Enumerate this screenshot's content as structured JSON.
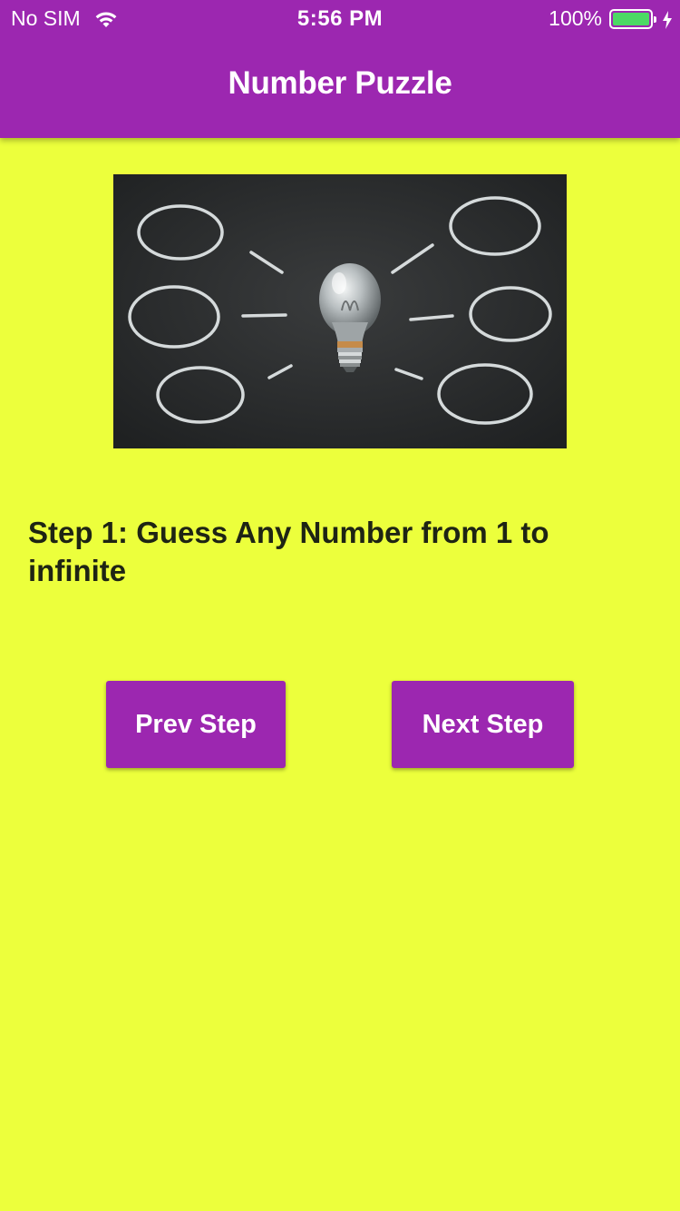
{
  "status_bar": {
    "carrier": "No SIM",
    "time": "5:56 PM",
    "battery_percent": "100%",
    "battery_level": 1.0,
    "icons": [
      "wifi-icon",
      "battery-icon",
      "charging-bolt-icon"
    ]
  },
  "app_bar": {
    "title": "Number Puzzle",
    "color": "#9c27b0"
  },
  "hero_image": {
    "icon": "lightbulb-chalkboard-image"
  },
  "content": {
    "step_text": "Step 1: Guess Any Number from 1 to infinite"
  },
  "buttons": {
    "prev_label": "Prev Step",
    "next_label": "Next Step"
  },
  "colors": {
    "background": "#ecff3c",
    "accent": "#9c27b0",
    "battery_fill": "#4cd964"
  }
}
